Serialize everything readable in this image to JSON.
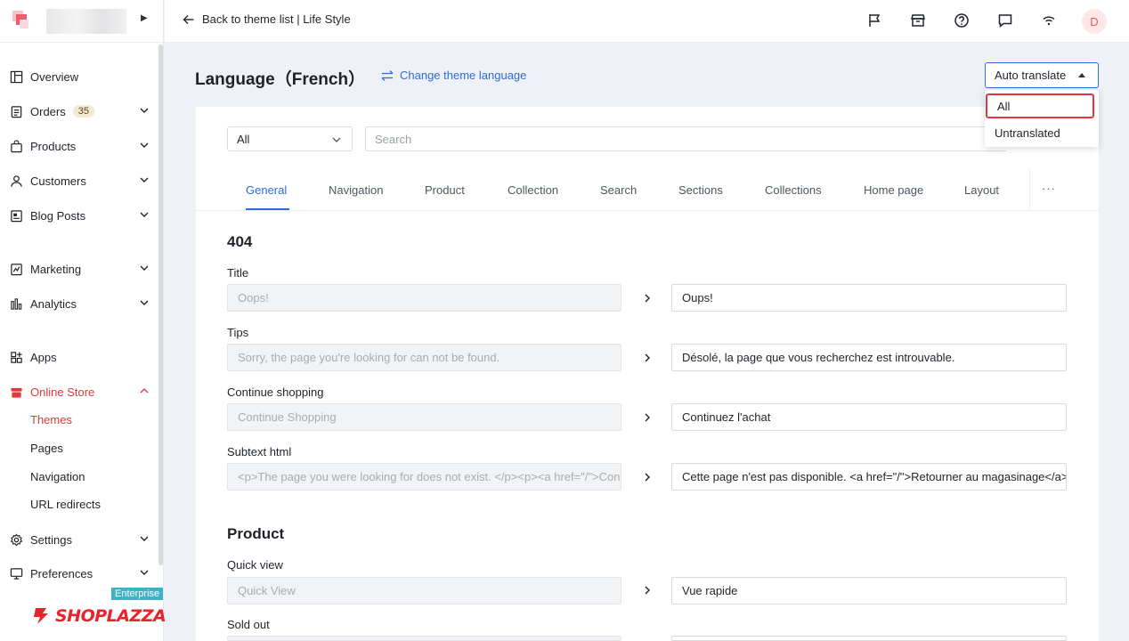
{
  "topbar": {
    "back_label": "Back to theme list | Life Style",
    "avatar_initial": "D"
  },
  "sidebar": {
    "items": [
      {
        "label": "Overview",
        "icon": "dashboard-icon"
      },
      {
        "label": "Orders",
        "badge": "35",
        "icon": "orders-icon"
      },
      {
        "label": "Products",
        "icon": "bag-icon"
      },
      {
        "label": "Customers",
        "icon": "user-icon"
      },
      {
        "label": "Blog Posts",
        "icon": "blog-icon"
      },
      {
        "label": "Marketing",
        "icon": "marketing-icon"
      },
      {
        "label": "Analytics",
        "icon": "analytics-icon"
      },
      {
        "label": "Apps",
        "icon": "apps-icon"
      },
      {
        "label": "Online Store",
        "icon": "store-icon"
      },
      {
        "label": "Settings",
        "icon": "gear-icon"
      },
      {
        "label": "Preferences",
        "icon": "monitor-icon"
      }
    ],
    "store_sub": [
      "Themes",
      "Pages",
      "Navigation",
      "URL redirects"
    ],
    "enterprise_badge": "Enterprise",
    "brand": "SHOPLAZZA"
  },
  "header": {
    "title": "Language（French）",
    "change_language": "Change theme language",
    "auto_translate": "Auto translate"
  },
  "dropdown": {
    "options": [
      "All",
      "Untranslated"
    ],
    "selected": "All"
  },
  "filter": {
    "select_value": "All",
    "search_placeholder": "Search"
  },
  "tabs": [
    "General",
    "Navigation",
    "Product",
    "Collection",
    "Search",
    "Sections",
    "Collections",
    "Home page",
    "Layout"
  ],
  "tabs_more": "···",
  "sections": [
    {
      "title": "404",
      "fields": [
        {
          "label": "Title",
          "source": "Oops!",
          "translation": "Oups!"
        },
        {
          "label": "Tips",
          "source": "Sorry, the page you're looking for can not be found.",
          "translation": "Désolé, la page que vous recherchez est introuvable."
        },
        {
          "label": "Continue shopping",
          "source": "Continue Shopping",
          "translation": "Continuez l'achat"
        },
        {
          "label": "Subtext html",
          "source": "<p>The page you were looking for does not exist. </p><p><a href=\"/\">Continue shopping</a></p>",
          "translation": "Cette page n'est pas disponible. <a href=\"/\">Retourner au magasinage</a>"
        }
      ]
    },
    {
      "title": "Product",
      "fields": [
        {
          "label": "Quick view",
          "source": "Quick View",
          "translation": "Vue rapide"
        },
        {
          "label": "Sold out",
          "source": "",
          "translation": ""
        }
      ]
    }
  ]
}
